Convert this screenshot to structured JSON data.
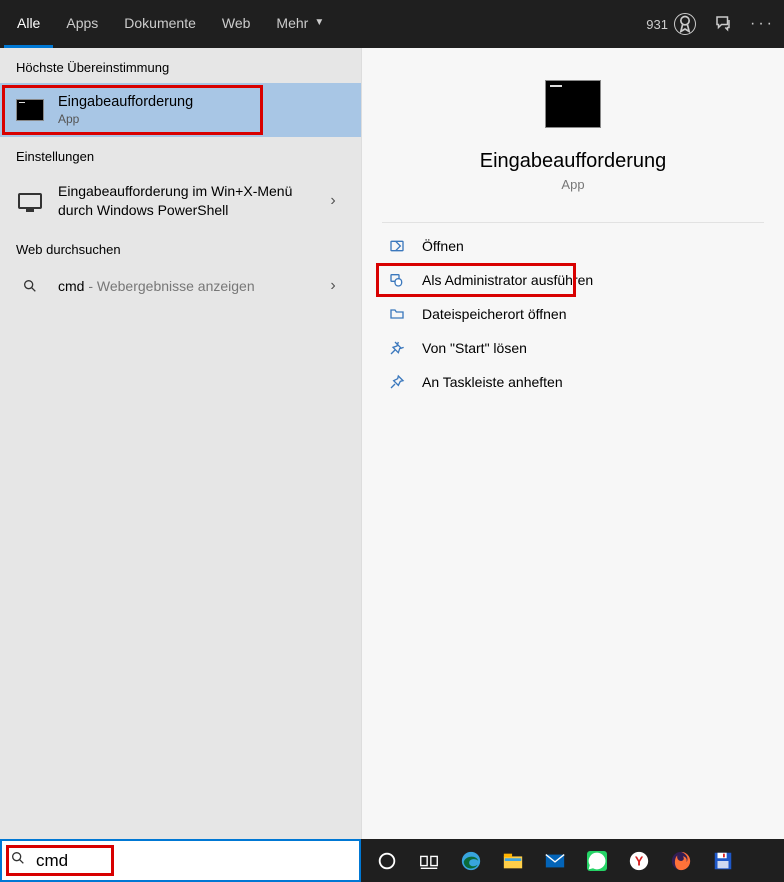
{
  "topbar": {
    "tabs": [
      "Alle",
      "Apps",
      "Dokumente",
      "Web",
      "Mehr"
    ],
    "points": "931"
  },
  "left": {
    "best_match_header": "Höchste Übereinstimmung",
    "best_match": {
      "title": "Eingabeaufforderung",
      "sub": "App"
    },
    "settings_header": "Einstellungen",
    "settings_item": {
      "title": "Eingabeaufforderung im Win+X-Menü durch Windows PowerShell"
    },
    "web_header": "Web durchsuchen",
    "web_item": {
      "query": "cmd",
      "suffix": " - Webergebnisse anzeigen"
    }
  },
  "detail": {
    "title": "Eingabeaufforderung",
    "sub": "App",
    "actions": [
      "Öffnen",
      "Als Administrator ausführen",
      "Dateispeicherort öffnen",
      "Von \"Start\" lösen",
      "An Taskleiste anheften"
    ]
  },
  "search": {
    "value": "cmd"
  }
}
